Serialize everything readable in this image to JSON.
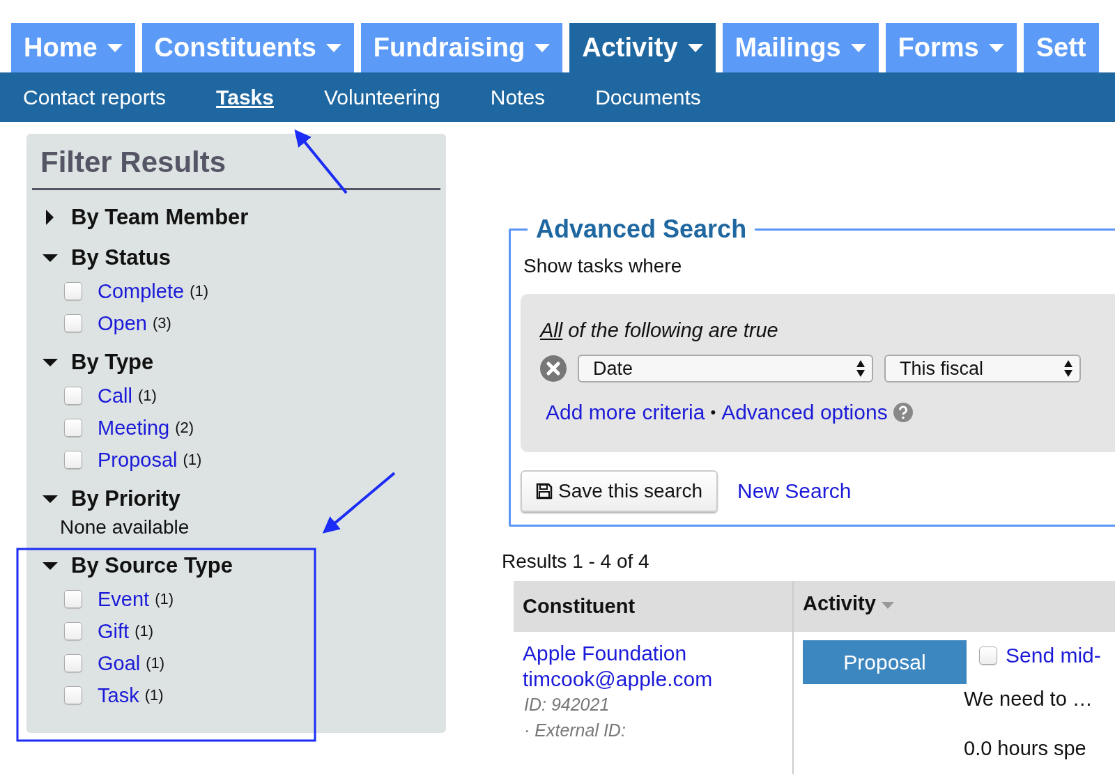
{
  "nav": {
    "tabs": [
      {
        "label": "Home",
        "selected": false
      },
      {
        "label": "Constituents",
        "selected": false
      },
      {
        "label": "Fundraising",
        "selected": false
      },
      {
        "label": "Activity",
        "selected": true
      },
      {
        "label": "Mailings",
        "selected": false
      },
      {
        "label": "Forms",
        "selected": false
      },
      {
        "label": "Sett",
        "selected": false
      }
    ],
    "subtabs": [
      {
        "label": "Contact reports",
        "selected": false
      },
      {
        "label": "Tasks",
        "selected": true
      },
      {
        "label": "Volunteering",
        "selected": false
      },
      {
        "label": "Notes",
        "selected": false
      },
      {
        "label": "Documents",
        "selected": false
      }
    ]
  },
  "filter": {
    "title": "Filter Results",
    "groups": [
      {
        "title": "By Team Member",
        "expanded": false
      },
      {
        "title": "By Status",
        "expanded": true,
        "items": [
          {
            "label": "Complete",
            "count": "(1)",
            "checked": false
          },
          {
            "label": "Open",
            "count": "(3)",
            "checked": false
          }
        ]
      },
      {
        "title": "By Type",
        "expanded": true,
        "items": [
          {
            "label": "Call",
            "count": "(1)",
            "checked": false
          },
          {
            "label": "Meeting",
            "count": "(2)",
            "checked": false
          },
          {
            "label": "Proposal",
            "count": "(1)",
            "checked": false
          }
        ]
      },
      {
        "title": "By Priority",
        "expanded": true,
        "empty_text": "None available"
      },
      {
        "title": "By Source Type",
        "expanded": true,
        "items": [
          {
            "label": "Event",
            "count": "(1)",
            "checked": false
          },
          {
            "label": "Gift",
            "count": "(1)",
            "checked": false
          },
          {
            "label": "Goal",
            "count": "(1)",
            "checked": false
          },
          {
            "label": "Task",
            "count": "(1)",
            "checked": false
          }
        ]
      }
    ]
  },
  "search": {
    "title": "Advanced Search",
    "intro": "Show tasks where",
    "match": "All",
    "match_rest": "of the following are true",
    "field": "Date",
    "range": "This fiscal",
    "links": [
      "Add more criteria",
      "•",
      "Advanced options"
    ],
    "save_button": "Save this search",
    "new_search": "New Search"
  },
  "results": {
    "summary": "Results 1 - 4 of 4",
    "columns": [
      {
        "label": "Constituent",
        "sorted": false
      },
      {
        "label": "Activity",
        "sorted": true
      }
    ],
    "rows": [
      {
        "name": "Apple Foundation",
        "email": "timcook@apple.com",
        "id": "ID: 942021",
        "external_id": "· External ID:",
        "type": "Proposal",
        "checked": false,
        "subject": "Send mid-",
        "description": "We need to …",
        "hours": "0.0 hours spe"
      }
    ]
  }
}
